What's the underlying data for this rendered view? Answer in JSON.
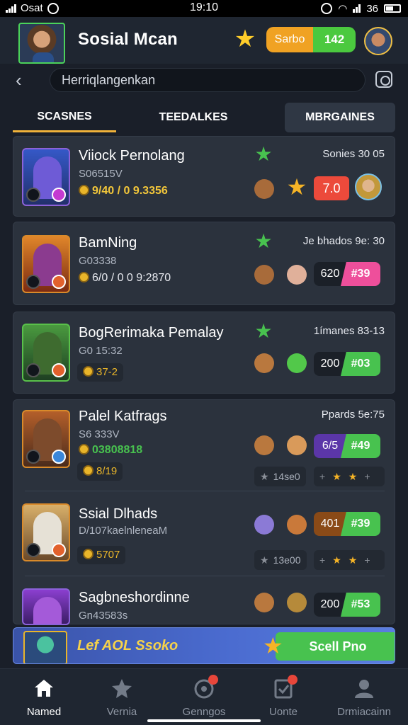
{
  "status_bar": {
    "carrier": "Osat",
    "time": "19:10",
    "signal_label": "36"
  },
  "header": {
    "title": "Sosial Mcan",
    "pill_left": "Sarbo",
    "pill_right": "142"
  },
  "search": {
    "value": "Herriqlangenkan"
  },
  "tabs": [
    {
      "label": "SCASNES"
    },
    {
      "label": "TEEDALKES"
    },
    {
      "label": "MBRGAINES"
    }
  ],
  "items": [
    {
      "title": "Viiock Pernolang",
      "subtitle": "S06515V",
      "stats": "9/40 / 0 9.3356",
      "meta": "Sonies 30 05",
      "score": "7.0"
    },
    {
      "title": "BamNing",
      "subtitle": "G03338",
      "stats": "6/0 / 0 0 9:2870",
      "meta": "Je bhados 9e: 30",
      "score_left": "620",
      "score_right": "#39"
    },
    {
      "title": "BogRerimaka Pemalay",
      "subtitle": "G0 15:32",
      "stats": "37-2",
      "meta": "1ímanes 83-13",
      "score_left": "200",
      "score_right": "#03"
    },
    {
      "title": "Palel Katfrags",
      "subtitle": "S6 333V",
      "stats": "03808818",
      "stats2": "8/19",
      "meta": "Ppards 5e:75",
      "score_left": "6/5",
      "score_right": "#49",
      "rating": "14se0"
    },
    {
      "title": "Ssial Dlhads",
      "subtitle": "D/107kaelnleneaM",
      "stats": "5707",
      "score_left": "401",
      "score_right": "#39",
      "rating": "13e00"
    },
    {
      "title": "Sagbneshordinne",
      "subtitle": "Gn43583s",
      "score_left": "200",
      "score_right": "#53"
    }
  ],
  "promo": {
    "text": "Lef AOL Ssoko",
    "button": "Scell Pno"
  },
  "nav": [
    {
      "label": "Named"
    },
    {
      "label": "Vernia"
    },
    {
      "label": "Genngos"
    },
    {
      "label": "Uonte"
    },
    {
      "label": "Drmiacainn"
    }
  ],
  "colors": {
    "accent_green": "#48c24f",
    "accent_gold": "#f0b23a",
    "accent_red": "#ec4a3b",
    "bg": "#1a1f29"
  }
}
